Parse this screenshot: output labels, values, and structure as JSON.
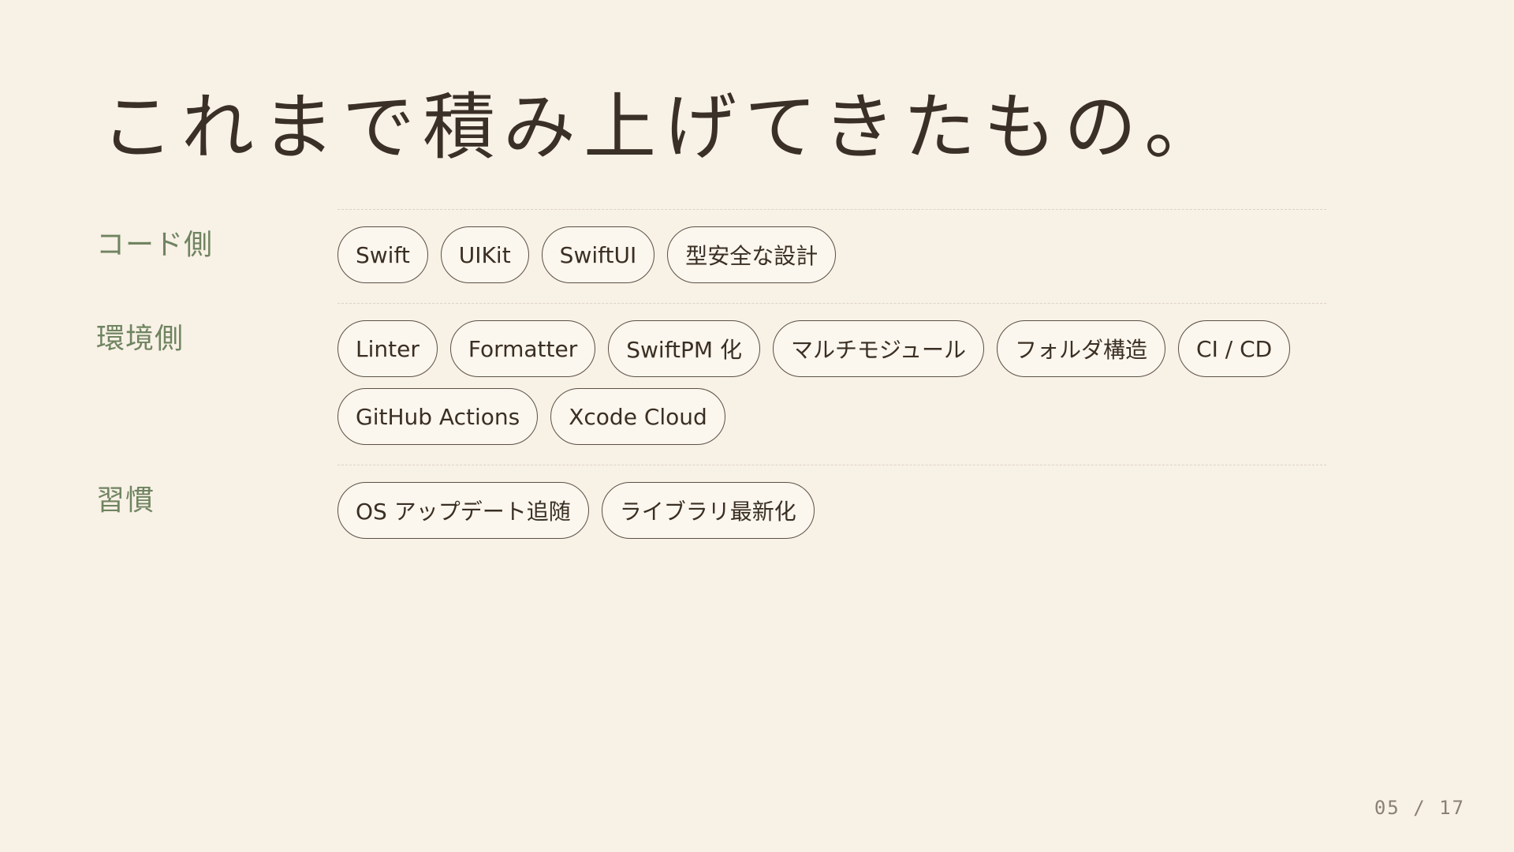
{
  "slide": {
    "title": "これまで積み上げてきたもの。",
    "page_indicator": "05 / 17"
  },
  "sections": [
    {
      "label": "コード側",
      "chips": [
        "Swift",
        "UIKit",
        "SwiftUI",
        "型安全な設計"
      ]
    },
    {
      "label": "環境側",
      "chips": [
        "Linter",
        "Formatter",
        "SwiftPM 化",
        "マルチモジュール",
        "フォルダ構造",
        "CI / CD",
        "GitHub Actions",
        "Xcode Cloud"
      ]
    },
    {
      "label": "習慣",
      "chips": [
        "OS アップデート追随",
        "ライブラリ最新化"
      ]
    }
  ],
  "colors": {
    "background": "#f8f1e6",
    "title": "#3b3027",
    "section_label": "#6f8460",
    "chip_border": "#5b5045",
    "page_indicator": "#8a8076"
  }
}
